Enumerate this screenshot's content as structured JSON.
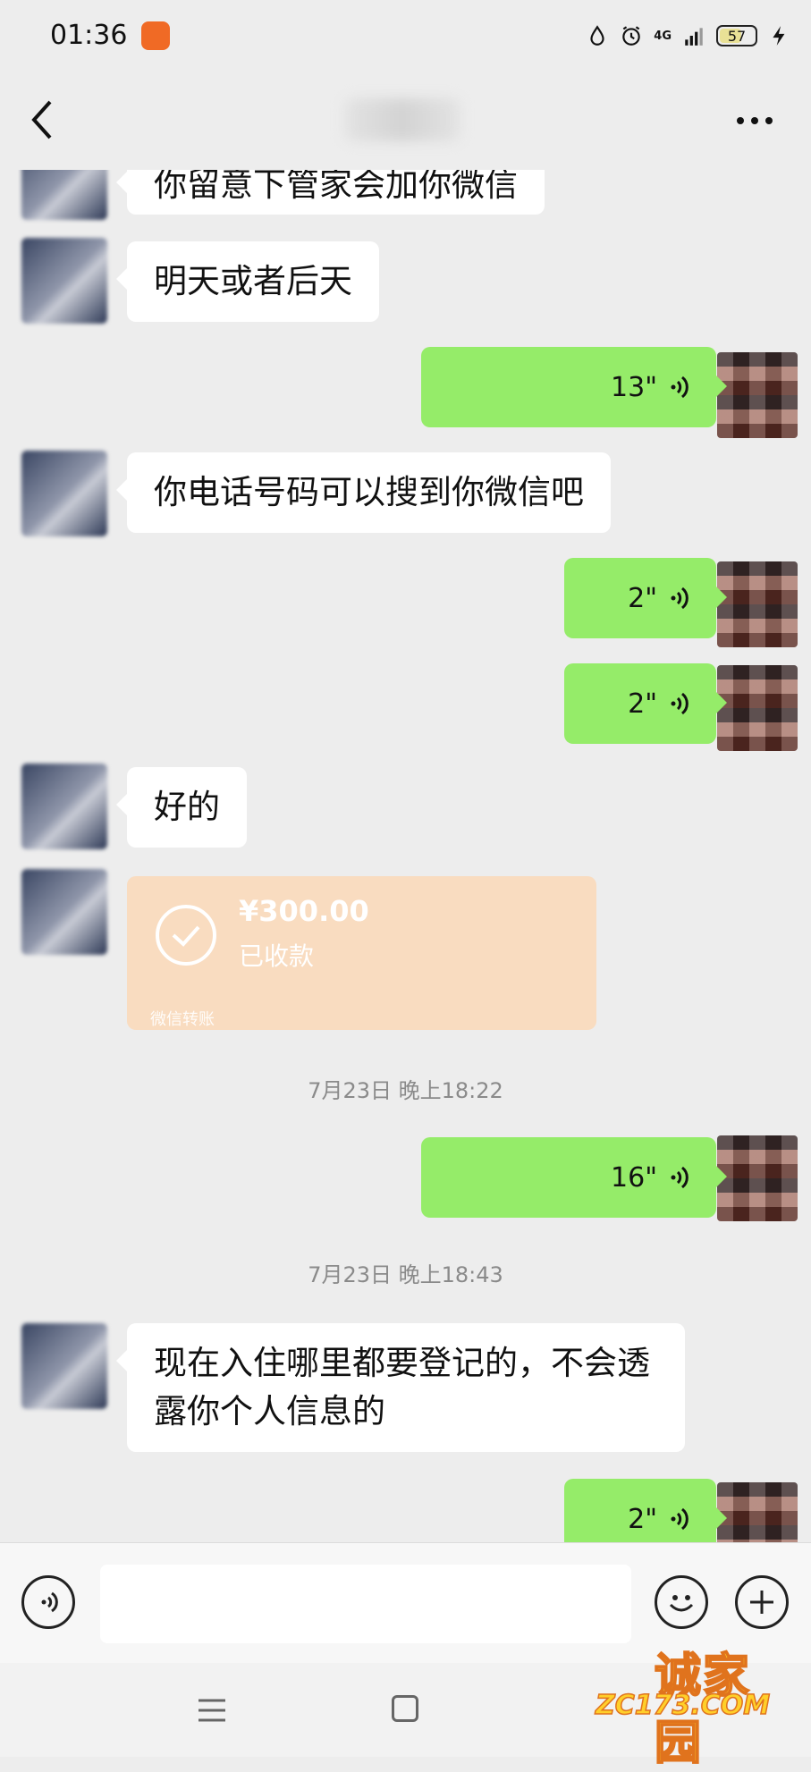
{
  "status_bar": {
    "time": "01:36",
    "network": "4G",
    "battery": "57"
  },
  "header": {
    "title": ""
  },
  "messages": [
    {
      "text": "你留意下管家会加你微信"
    },
    {
      "text": "明天或者后天"
    },
    {
      "duration": "13\""
    },
    {
      "text": "你电话号码可以搜到你微信吧"
    },
    {
      "duration": "2\""
    },
    {
      "duration": "2\""
    },
    {
      "text": "好的"
    },
    {
      "amount": "¥300.00",
      "status": "已收款",
      "footer": "微信转账"
    },
    {
      "timestamp": "7月23日 晚上18:22"
    },
    {
      "duration": "16\""
    },
    {
      "timestamp": "7月23日 晚上18:43"
    },
    {
      "text": "现在入住哪里都要登记的，不会透露你个人信息的"
    },
    {
      "duration": "2\""
    }
  ],
  "input_bar": {
    "placeholder": ""
  },
  "watermark": {
    "title": "诚家园",
    "url": "ZC173.COM"
  },
  "colors": {
    "background": "#ededed",
    "sent_bubble": "#95ec69",
    "received_bubble": "#ffffff",
    "transfer_card": "#f9dcc0"
  }
}
